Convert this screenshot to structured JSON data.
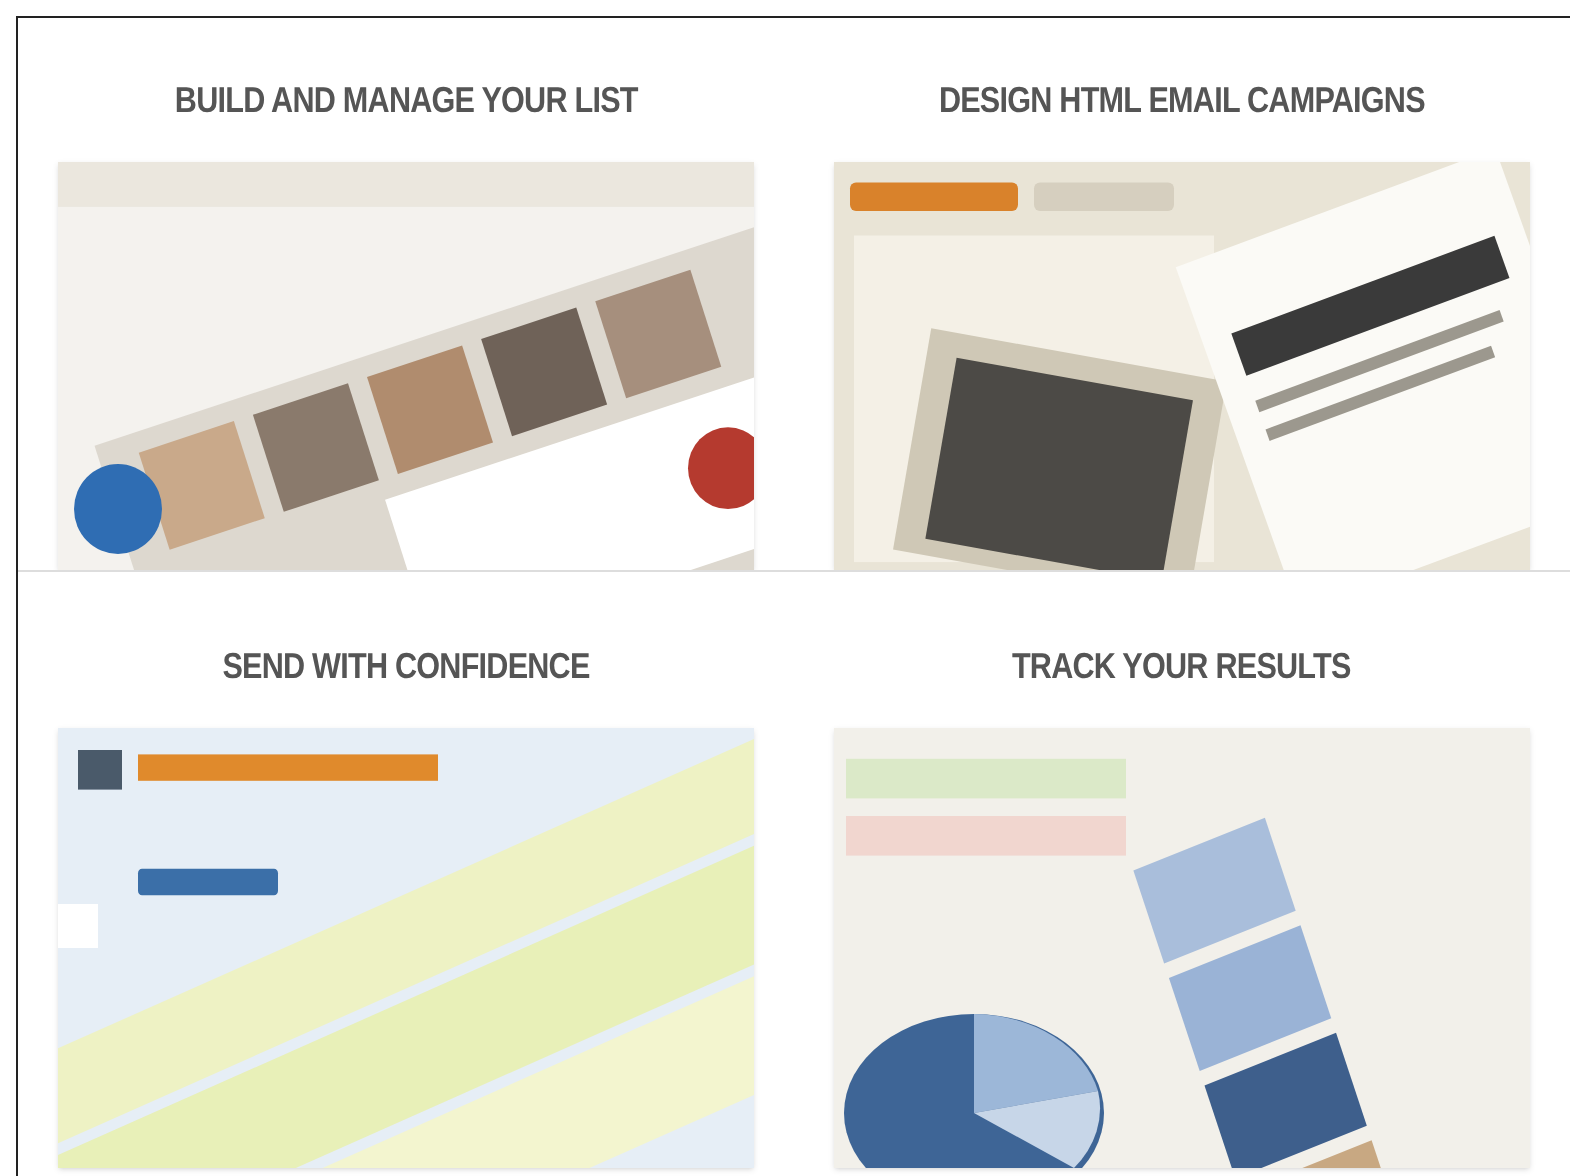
{
  "sections": [
    {
      "title": "BUILD AND MANAGE YOUR LIST"
    },
    {
      "title": "DESIGN HTML EMAIL CAMPAIGNS"
    },
    {
      "title": "SEND WITH CONFIDENCE"
    },
    {
      "title": "TRACK YOUR RESULTS"
    }
  ]
}
